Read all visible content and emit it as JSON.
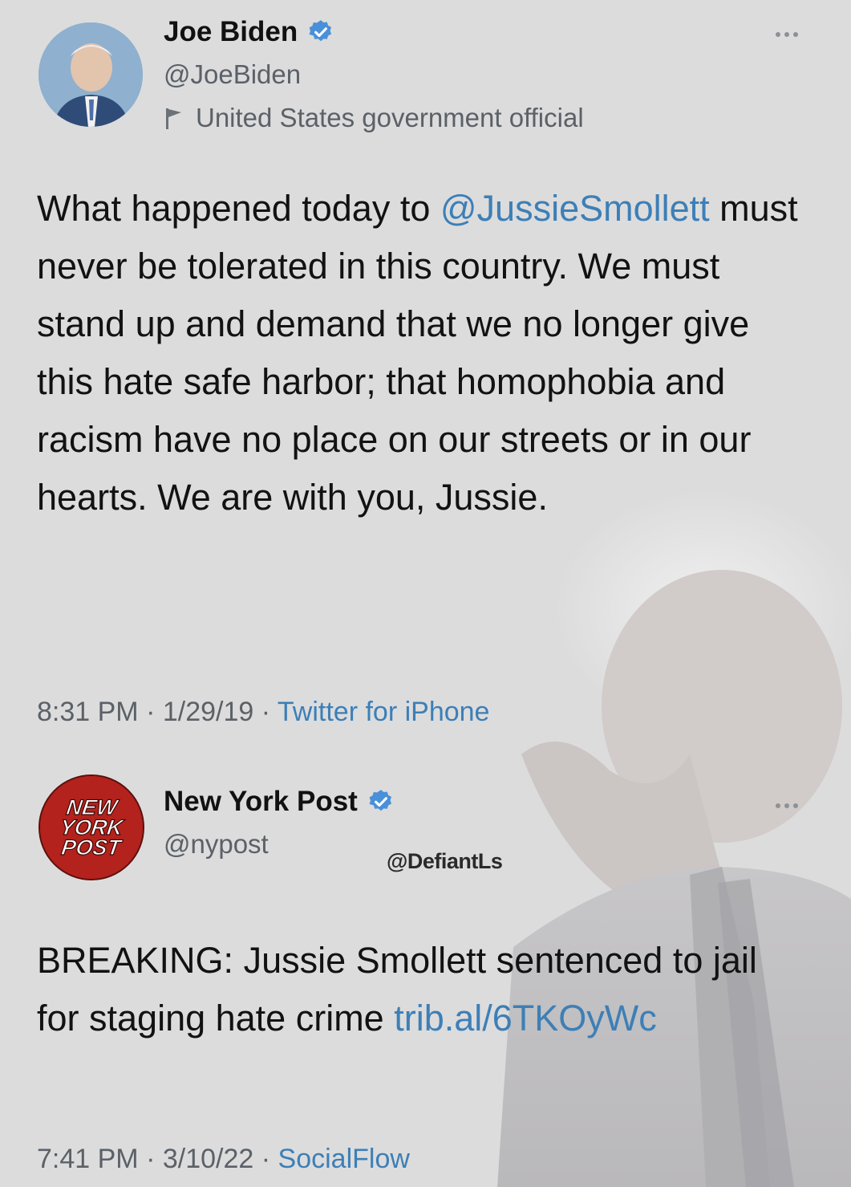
{
  "tweets": [
    {
      "display_name": "Joe Biden",
      "handle": "@JoeBiden",
      "label": "United States government official",
      "text_before_mention": "What happened today to ",
      "mention": "@JussieSmollett",
      "text_after_mention": " must never be tolerated in this country. We must stand up and demand that we no longer give this hate safe harbor; that homophobia and racism have no place on our streets or in our hearts. We are with you, Jussie.",
      "time": "8:31 PM",
      "date": "1/29/19",
      "source": "Twitter for iPhone",
      "icons": [
        "avatar",
        "verified-badge-icon",
        "government-flag-icon",
        "more-options-icon"
      ]
    },
    {
      "display_name": "New York Post",
      "handle": "@nypost",
      "avatar_logo_text": "NEW YORK POST",
      "text": "BREAKING: Jussie Smollett sentenced to jail for staging hate crime ",
      "link": "trib.al/6TKOyWc",
      "time": "7:41 PM",
      "date": "3/10/22",
      "source": "SocialFlow",
      "icons": [
        "avatar",
        "verified-badge-icon",
        "more-options-icon"
      ]
    }
  ],
  "meta_separator": " · ",
  "watermark": "@DefiantLs",
  "colors": {
    "background": "#dcdcdd",
    "link": "#3d7fb6",
    "verified": "#4a90d9",
    "secondary_text": "#5b6167",
    "nypost_red": "#b3221c"
  }
}
